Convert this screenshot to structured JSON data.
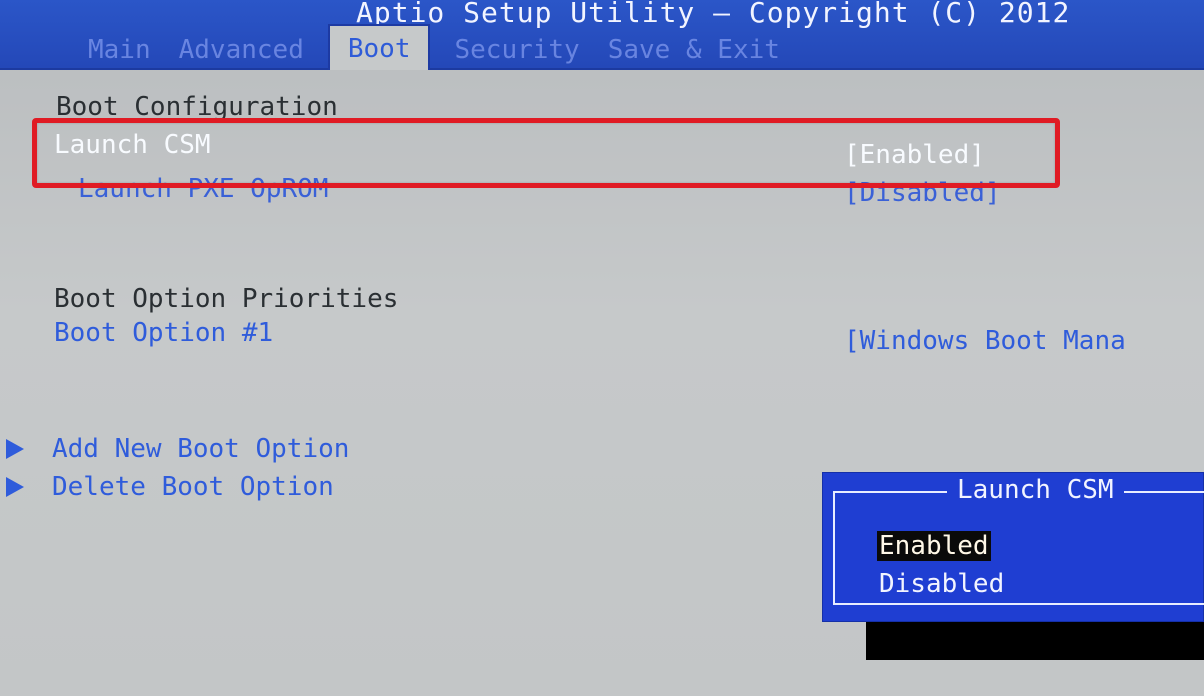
{
  "header": {
    "title": "Aptio Setup Utility – Copyright (C) 2012",
    "tabs": [
      {
        "label": "Main",
        "active": false
      },
      {
        "label": "Advanced",
        "active": false
      },
      {
        "label": "Boot",
        "active": true
      },
      {
        "label": "Security",
        "active": false
      },
      {
        "label": "Save & Exit",
        "active": false
      }
    ]
  },
  "main": {
    "boot_configuration": "Boot Configuration",
    "launch_csm": {
      "label": "Launch CSM",
      "value": "[Enabled]"
    },
    "launch_pxe": {
      "label": "Launch PXE OpROM",
      "value": "[Disabled]"
    },
    "boot_option_priorities": "Boot Option Priorities",
    "boot_option_1": {
      "label": "Boot Option #1",
      "value": "[Windows Boot Mana"
    },
    "submenus": [
      {
        "label": "Add New Boot Option"
      },
      {
        "label": "Delete Boot Option"
      }
    ]
  },
  "popup": {
    "title": "Launch CSM",
    "options": [
      {
        "label": "Enabled",
        "selected": true
      },
      {
        "label": "Disabled",
        "selected": false
      }
    ]
  },
  "colors": {
    "header_blue": "#2448b8",
    "panel_gray": "#c6c9ca",
    "link_blue": "#2f5cdb",
    "highlight_red": "#e01b24",
    "popup_blue": "#1f3ed2"
  },
  "icons": {
    "submenu_arrow": "triangle-right-icon"
  }
}
